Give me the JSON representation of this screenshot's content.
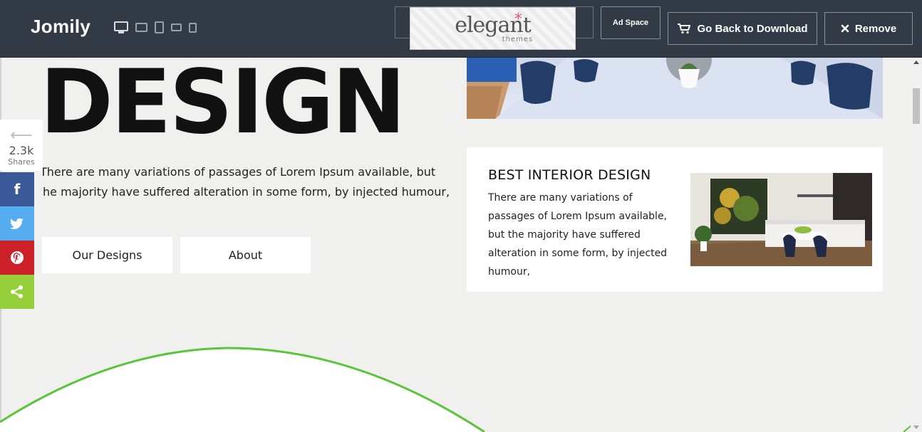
{
  "topbar": {
    "brand": "Jomily",
    "devices": [
      "desktop-icon",
      "tablet-landscape-icon",
      "tablet-portrait-icon",
      "phone-landscape-icon",
      "phone-portrait-icon"
    ],
    "ad_logo": "elegant",
    "ad_logo_sub": "themes",
    "ad_space_label": "Ad Space",
    "download_label": "Go Back to Download",
    "remove_label": "Remove",
    "colors": {
      "bar": "#323a46",
      "button_border": "#8a9099"
    }
  },
  "hero": {
    "title": "DESIGN",
    "lead_line1": "There are many variations of passages of Lorem Ipsum available, but",
    "lead_line2": "he majority have suffered alteration in some form, by injected humour,",
    "buttons": [
      "Our Designs",
      "About"
    ]
  },
  "card": {
    "title": "BEST INTERIOR DESIGN",
    "text": "There are many variations of passages of Lorem Ipsum available, but the majority have suffered alteration in some form, by injected humour,"
  },
  "share": {
    "count": "2.3k",
    "label": "Shares",
    "networks": [
      "facebook-icon",
      "twitter-icon",
      "pinterest-icon",
      "share-icon"
    ],
    "colors": {
      "facebook": "#3b5998",
      "twitter": "#55acee",
      "pinterest": "#cb2027",
      "share": "#95d03a"
    }
  },
  "decor": {
    "arc_color": "#5ac43a"
  }
}
